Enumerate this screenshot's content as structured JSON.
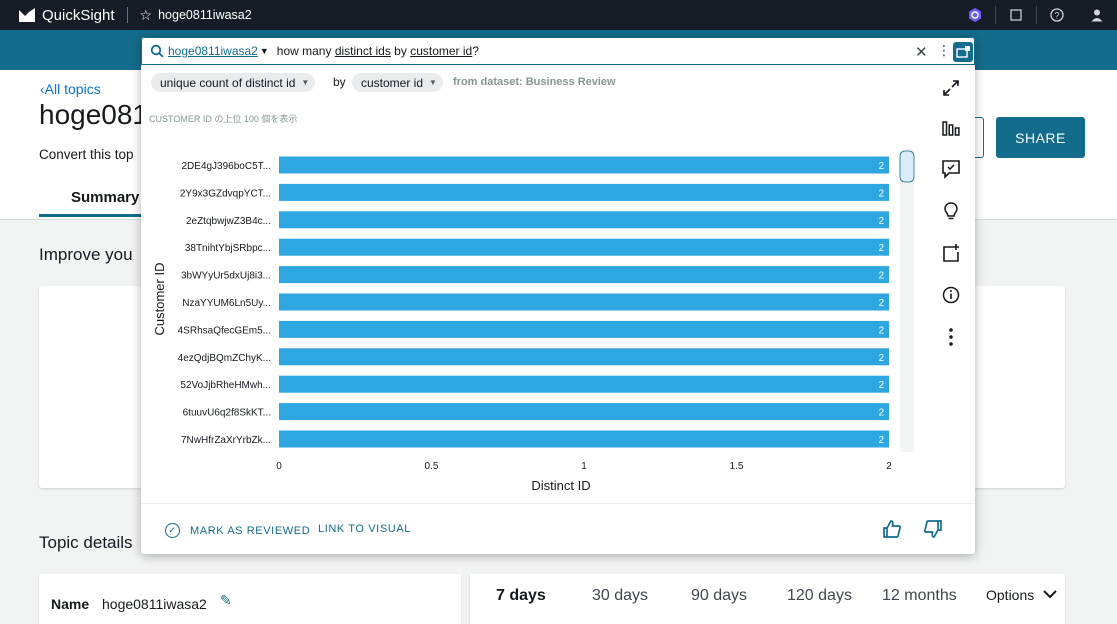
{
  "app": {
    "name": "QuickSight",
    "topic": "hoge0811iwasa2"
  },
  "page": {
    "back_link": "All topics",
    "title": "hoge0811iwasa2",
    "subtitle": "Convert this top",
    "tab": "Summary",
    "share_label": "SHARE",
    "improve_heading": "Improve you",
    "details_heading": "Topic details",
    "name_label": "Name",
    "name_value": "hoge0811iwasa2",
    "ranges": [
      "7 days",
      "30 days",
      "90 days",
      "120 days",
      "12 months"
    ],
    "options_label": "Options"
  },
  "qbar": {
    "topic": "hoge0811iwasa2",
    "q_prefix": "how many ",
    "q_field1": "distinct ids",
    "q_mid": " by ",
    "q_field2": "customer id",
    "q_suffix": "?"
  },
  "interpretation": {
    "measure": "unique count of distinct id",
    "by": "by",
    "dimension": "customer id",
    "dataset": "from dataset: Business Review"
  },
  "caption": "CUSTOMER ID の上位 100 個を表示",
  "footer": {
    "mark_reviewed": "MARK AS REVIEWED",
    "link_visual": "LINK TO VISUAL"
  },
  "colors": {
    "bar": "#2ea6df",
    "accent": "#146c8c",
    "topbar": "#161d26"
  },
  "chart_data": {
    "type": "bar",
    "orientation": "horizontal",
    "categories": [
      "2DE4gJ396boC5T...",
      "2Y9x3GZdvqpYCT...",
      "2eZtqbwjwZ3B4c...",
      "38TnihtYbjSRbpc...",
      "3bWYyUr5dxUj8i3...",
      "NzaYYUM6Ln5Uy...",
      "4SRhsaQfecGEm5...",
      "4ezQdjBQmZChyK...",
      "52VoJjbRheHMwh...",
      "6tuuvU6q2f8SkKT...",
      "7NwHfrZaXrYrbZk..."
    ],
    "values": [
      2,
      2,
      2,
      2,
      2,
      2,
      2,
      2,
      2,
      2,
      2
    ],
    "xlabel": "Distinct ID",
    "ylabel": "Customer ID",
    "xlim": [
      0,
      2
    ],
    "xticks": [
      "0",
      "0.5",
      "1",
      "1.5",
      "2"
    ]
  }
}
